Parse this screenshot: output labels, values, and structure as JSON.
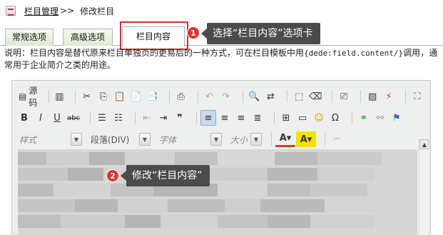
{
  "breadcrumb": {
    "section": "栏目管理",
    "separator": ">>",
    "current": "修改栏目"
  },
  "tabs": [
    {
      "label": "常规选项"
    },
    {
      "label": "高级选项"
    },
    {
      "label": "栏目内容"
    }
  ],
  "annotations": {
    "step1": {
      "number": "1",
      "text": "选择“栏目内容”选项卡"
    },
    "step2": {
      "number": "2",
      "text": "修改“栏目内容”"
    }
  },
  "description": {
    "prefix": "说明：栏目内容是替代原来栏目单独页的更易后的一种方式，可在栏目模板中用",
    "code": "{dede:field.content/}",
    "suffix": "调用，通常用于企业简介之类的用途。"
  },
  "editor": {
    "source_label": "源码",
    "style_combo": "样式",
    "format_combo": "段落(DIV)",
    "font_combo": "字体",
    "size_combo": "大小"
  },
  "colors": {
    "highlight": "#d9302c",
    "callout_bg": "#4b4b4b",
    "badge": "#e0322f"
  }
}
